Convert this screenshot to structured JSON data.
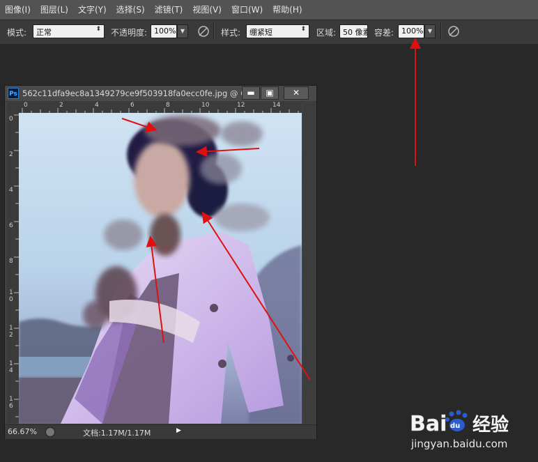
{
  "menu": [
    "图像(I)",
    "图层(L)",
    "文字(Y)",
    "选择(S)",
    "滤镜(T)",
    "视图(V)",
    "窗口(W)",
    "帮助(H)"
  ],
  "options": {
    "mode_label": "模式:",
    "mode_value": "正常",
    "opacity_label": "不透明度:",
    "opacity_value": "100%",
    "style_label": "样式:",
    "style_value": "绷紧短",
    "area_label": "区域:",
    "area_value": "50 像素",
    "tolerance_label": "容差:",
    "tolerance_value": "100%"
  },
  "document": {
    "title": "562c11dfa9ec8a1349279ce9f503918fa0ecc0fe.jpg @ 6...",
    "ps_badge": "Ps",
    "minimize": "▬",
    "maximize": "▣",
    "close": "✕",
    "ruler_top": [
      "0",
      "2",
      "4",
      "6",
      "8",
      "10",
      "12",
      "14"
    ],
    "ruler_left": [
      "0",
      "2",
      "4",
      "6",
      "8",
      "1\n0",
      "1\n2",
      "1\n4",
      "1\n6"
    ],
    "zoom": "66.67%",
    "doc_info": "文档:1.17M/1.17M"
  },
  "watermark": {
    "brand": "Bai",
    "brand2": "du",
    "cn": "经验",
    "url": "jingyan.baidu.com"
  },
  "colors": {
    "menubar": "#535353",
    "optionbar": "#3a3a3a",
    "workspace": "#282828",
    "arrow": "#e01010",
    "baidu_blue": "#2a5ccf"
  },
  "icons": [
    "brush-pressure-icon",
    "brush-pressure-icon-2",
    "ps-logo-icon",
    "status-icon",
    "status-arrow-icon"
  ]
}
